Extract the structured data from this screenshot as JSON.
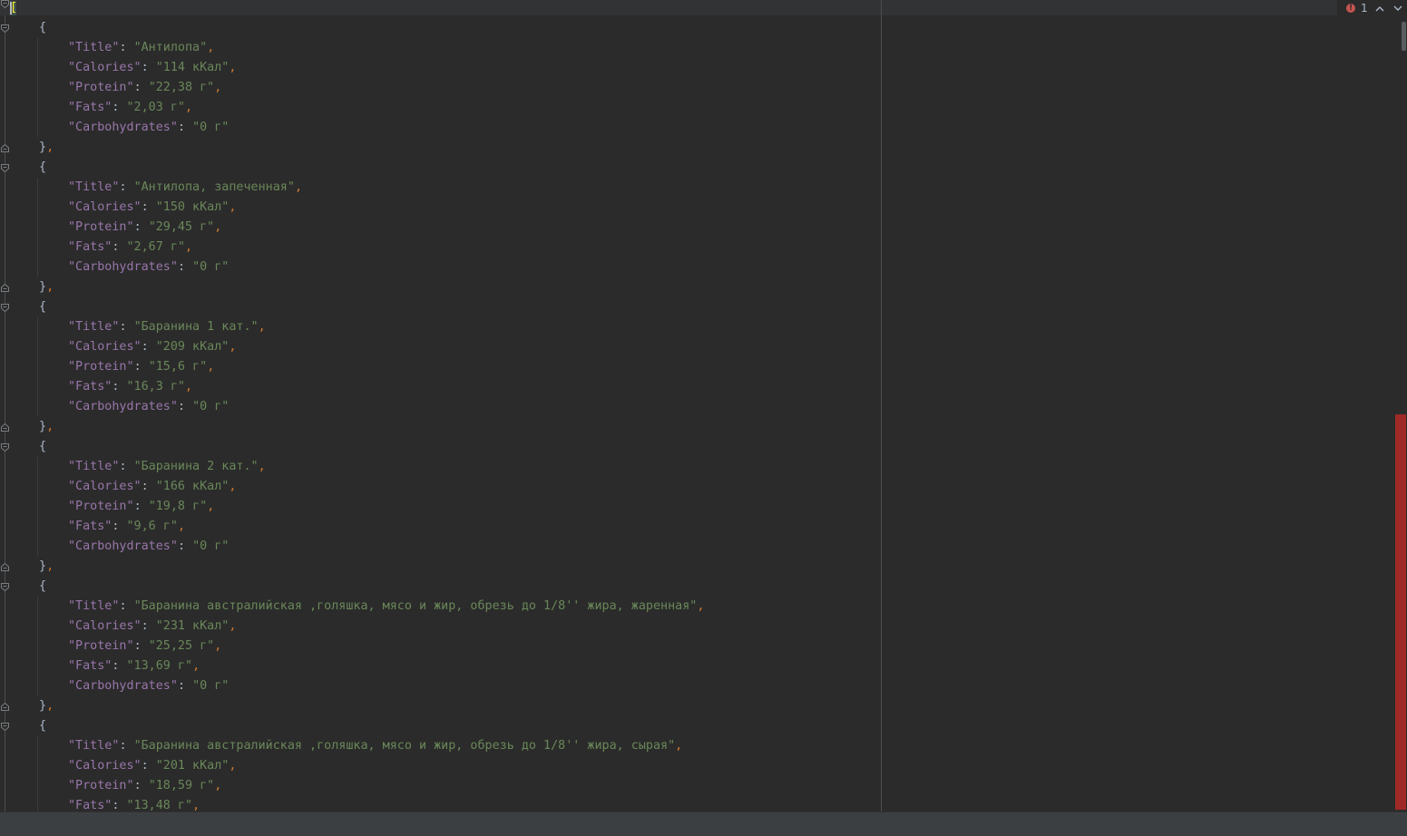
{
  "editor": {
    "lines": [
      {
        "t": "open_array",
        "fold": true
      },
      {
        "t": "open_obj",
        "fold": true
      },
      {
        "t": "kv",
        "key": "\"Title\"",
        "val": "\"Антилопа\"",
        "comma": true
      },
      {
        "t": "kv",
        "key": "\"Calories\"",
        "val": "\"114 кКал\"",
        "comma": true
      },
      {
        "t": "kv",
        "key": "\"Protein\"",
        "val": "\"22,38 г\"",
        "comma": true
      },
      {
        "t": "kv",
        "key": "\"Fats\"",
        "val": "\"2,03 г\"",
        "comma": true
      },
      {
        "t": "kv",
        "key": "\"Carbohydrates\"",
        "val": "\"0 г\"",
        "comma": false
      },
      {
        "t": "close_obj",
        "fold": true
      },
      {
        "t": "open_obj",
        "fold": true
      },
      {
        "t": "kv",
        "key": "\"Title\"",
        "val": "\"Антилопа, запеченная\"",
        "comma": true
      },
      {
        "t": "kv",
        "key": "\"Calories\"",
        "val": "\"150 кКал\"",
        "comma": true
      },
      {
        "t": "kv",
        "key": "\"Protein\"",
        "val": "\"29,45 г\"",
        "comma": true
      },
      {
        "t": "kv",
        "key": "\"Fats\"",
        "val": "\"2,67 г\"",
        "comma": true
      },
      {
        "t": "kv",
        "key": "\"Carbohydrates\"",
        "val": "\"0 г\"",
        "comma": false
      },
      {
        "t": "close_obj",
        "fold": true
      },
      {
        "t": "open_obj",
        "fold": true
      },
      {
        "t": "kv",
        "key": "\"Title\"",
        "val": "\"Баранина 1 кат.\"",
        "comma": true
      },
      {
        "t": "kv",
        "key": "\"Calories\"",
        "val": "\"209 кКал\"",
        "comma": true
      },
      {
        "t": "kv",
        "key": "\"Protein\"",
        "val": "\"15,6 г\"",
        "comma": true
      },
      {
        "t": "kv",
        "key": "\"Fats\"",
        "val": "\"16,3 г\"",
        "comma": true
      },
      {
        "t": "kv",
        "key": "\"Carbohydrates\"",
        "val": "\"0 г\"",
        "comma": false
      },
      {
        "t": "close_obj",
        "fold": true
      },
      {
        "t": "open_obj",
        "fold": true
      },
      {
        "t": "kv",
        "key": "\"Title\"",
        "val": "\"Баранина 2 кат.\"",
        "comma": true
      },
      {
        "t": "kv",
        "key": "\"Calories\"",
        "val": "\"166 кКал\"",
        "comma": true
      },
      {
        "t": "kv",
        "key": "\"Protein\"",
        "val": "\"19,8 г\"",
        "comma": true
      },
      {
        "t": "kv",
        "key": "\"Fats\"",
        "val": "\"9,6 г\"",
        "comma": true
      },
      {
        "t": "kv",
        "key": "\"Carbohydrates\"",
        "val": "\"0 г\"",
        "comma": false
      },
      {
        "t": "close_obj",
        "fold": true
      },
      {
        "t": "open_obj",
        "fold": true
      },
      {
        "t": "kv",
        "key": "\"Title\"",
        "val": "\"Баранина австралийская ,голяшка, мясо и жир, обрезь до 1/8'' жира, жаренная\"",
        "comma": true
      },
      {
        "t": "kv",
        "key": "\"Calories\"",
        "val": "\"231 кКал\"",
        "comma": true
      },
      {
        "t": "kv",
        "key": "\"Protein\"",
        "val": "\"25,25 г\"",
        "comma": true
      },
      {
        "t": "kv",
        "key": "\"Fats\"",
        "val": "\"13,69 г\"",
        "comma": true
      },
      {
        "t": "kv",
        "key": "\"Carbohydrates\"",
        "val": "\"0 г\"",
        "comma": false
      },
      {
        "t": "close_obj",
        "fold": true
      },
      {
        "t": "open_obj",
        "fold": true
      },
      {
        "t": "kv",
        "key": "\"Title\"",
        "val": "\"Баранина австралийская ,голяшка, мясо и жир, обрезь до 1/8'' жира, сырая\"",
        "comma": true
      },
      {
        "t": "kv",
        "key": "\"Calories\"",
        "val": "\"201 кКал\"",
        "comma": true
      },
      {
        "t": "kv",
        "key": "\"Protein\"",
        "val": "\"18,59 г\"",
        "comma": true
      },
      {
        "t": "kv",
        "key": "\"Fats\"",
        "val": "\"13,48 г\"",
        "comma": true
      }
    ]
  },
  "inspection": {
    "error_count": "1",
    "error_icon": "error-circle-icon",
    "prev_icon": "chevron-up-icon",
    "next_icon": "chevron-down-icon"
  },
  "colors": {
    "background": "#2b2b2b",
    "key": "#9876aa",
    "string": "#6a8759",
    "punctuation": "#a9b7c6",
    "comma": "#cc7832",
    "error_stripe": "#9e2927"
  }
}
